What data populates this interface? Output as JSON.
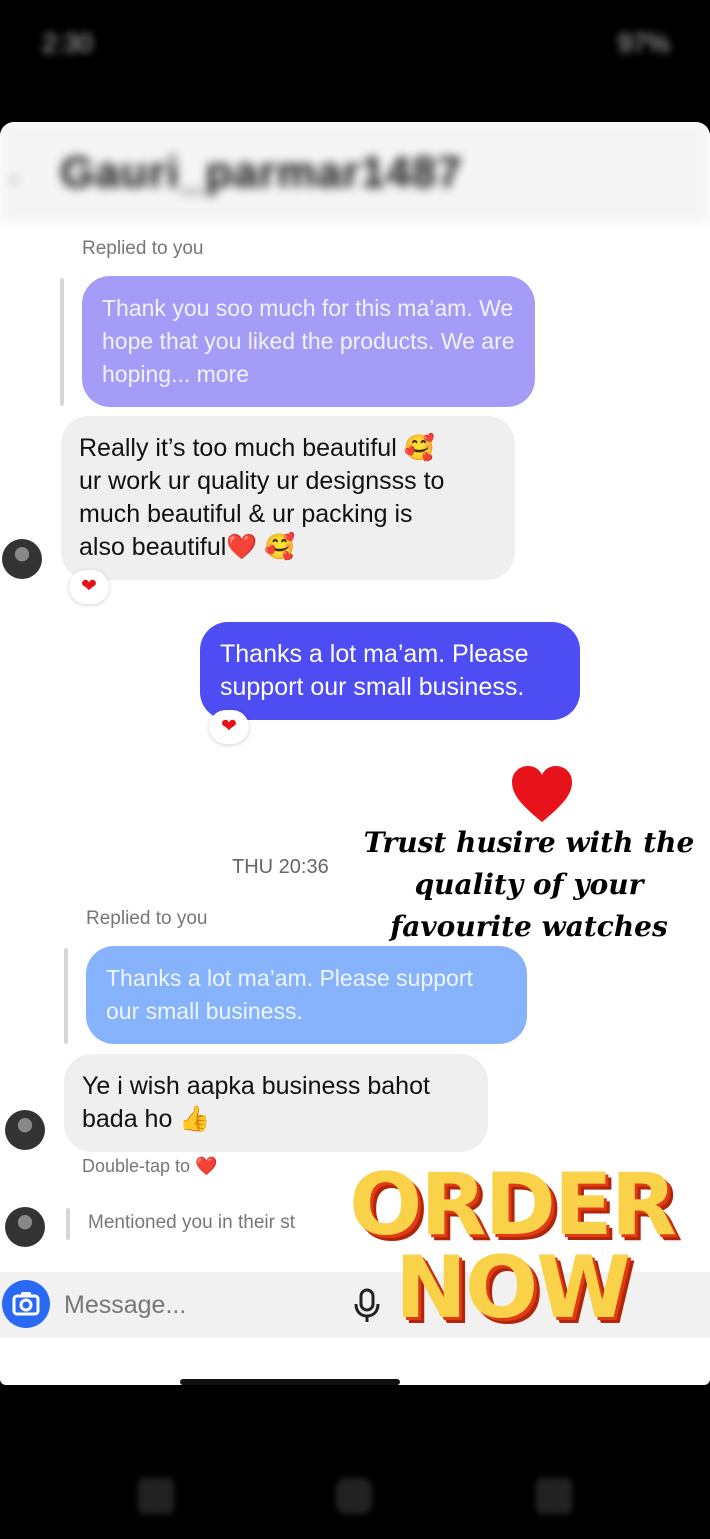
{
  "status": {
    "time": "2:30",
    "battery": "97%"
  },
  "header": {
    "username": "Gauri_parmar1487"
  },
  "thread": {
    "reply1_label": "Replied to you",
    "quoted1": "Thank you soo much for this ma’am. We hope that you liked the products. We are hoping... more",
    "incoming1_line1": "Really it’s too much beautiful 🥰",
    "incoming1_line2": "ur work ur quality ur designsss to",
    "incoming1_line3": "much beautiful & ur packing is",
    "incoming1_line4": "also beautiful❤️ 🥰",
    "reaction": "❤",
    "outgoing1": "Thanks a lot ma’am. Please support our small business.",
    "timestamp": "THU 20:36",
    "reply2_label": "Replied to you",
    "quoted2": "Thanks a lot ma’am. Please support our small business.",
    "incoming2": "Ye i wish aapka business bahot bada ho 👍",
    "doubletap": "Double-tap to ❤️",
    "mention": "Mentioned you in their st"
  },
  "composer": {
    "placeholder": "Message..."
  },
  "promo": {
    "tagline": "Trust husire with the quality of your favourite watches",
    "order_line1": "ORDER",
    "order_line2": "NOW"
  },
  "colors": {
    "outgoing": "#4e4cf3",
    "quoted_purple": "#a59cf7",
    "quoted_blue": "#86b3fb",
    "incoming": "#efefef",
    "heart": "#e8121a",
    "order": "#f9d24a"
  },
  "icons": [
    "back-icon",
    "camera-icon",
    "mic-icon",
    "heart-icon"
  ]
}
